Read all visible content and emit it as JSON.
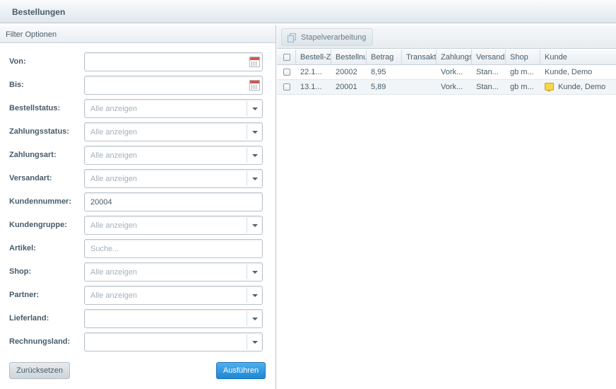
{
  "window": {
    "title": "Bestellungen"
  },
  "filter": {
    "header": "Filter Optionen",
    "fields": [
      {
        "label": "Von:",
        "value": "",
        "placeholder": "",
        "type": "date"
      },
      {
        "label": "Bis:",
        "value": "",
        "placeholder": "",
        "type": "date"
      },
      {
        "label": "Bestellstatus:",
        "value": "",
        "placeholder": "Alle anzeigen",
        "type": "combo"
      },
      {
        "label": "Zahlungsstatus:",
        "value": "",
        "placeholder": "Alle anzeigen",
        "type": "combo"
      },
      {
        "label": "Zahlungsart:",
        "value": "",
        "placeholder": "Alle anzeigen",
        "type": "combo"
      },
      {
        "label": "Versandart:",
        "value": "",
        "placeholder": "Alle anzeigen",
        "type": "combo"
      },
      {
        "label": "Kundennummer:",
        "value": "20004",
        "placeholder": "",
        "type": "text"
      },
      {
        "label": "Kundengruppe:",
        "value": "",
        "placeholder": "Alle anzeigen",
        "type": "combo"
      },
      {
        "label": "Artikel:",
        "value": "",
        "placeholder": "Suche...",
        "type": "text"
      },
      {
        "label": "Shop:",
        "value": "",
        "placeholder": "Alle anzeigen",
        "type": "combo"
      },
      {
        "label": "Partner:",
        "value": "",
        "placeholder": "Alle anzeigen",
        "type": "combo"
      },
      {
        "label": "Lieferland:",
        "value": "",
        "placeholder": "",
        "type": "combo"
      },
      {
        "label": "Rechnungsland:",
        "value": "",
        "placeholder": "",
        "type": "combo"
      }
    ],
    "reset_label": "Zurücksetzen",
    "run_label": "Ausführen"
  },
  "toolbar": {
    "batch_label": "Stapelverarbeitung",
    "batch_icon": "stack-icon"
  },
  "grid": {
    "columns": [
      "Bestell-Z",
      "Bestellnu",
      "Betrag",
      "Transakt",
      "Zahlungs",
      "Versand",
      "Shop",
      "Kunde"
    ],
    "rows": [
      {
        "date": "22.1...",
        "number": "20002",
        "amount": "8,95",
        "transaction": "",
        "payment": "Vork...",
        "shipping": "Stan...",
        "shop": "gb m...",
        "customer": "Kunde, Demo",
        "has_comment": false
      },
      {
        "date": "13.1...",
        "number": "20001",
        "amount": "5,89",
        "transaction": "",
        "payment": "Vork...",
        "shipping": "Stan...",
        "shop": "gb m...",
        "customer": "Kunde, Demo",
        "has_comment": true,
        "comment_icon": "comment-icon"
      }
    ]
  }
}
